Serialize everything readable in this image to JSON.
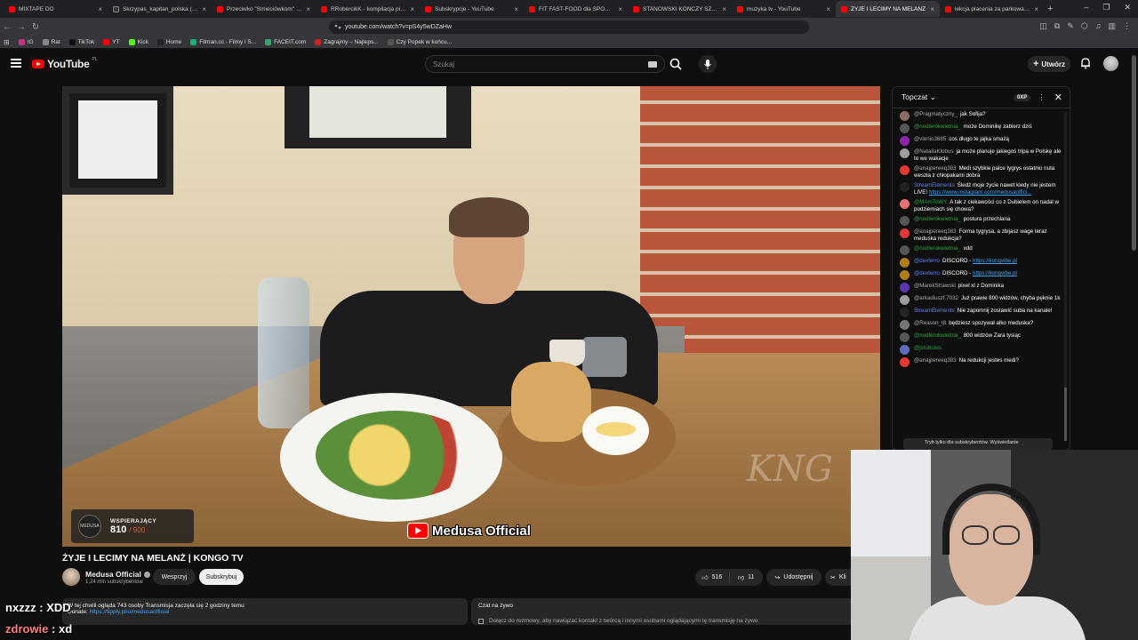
{
  "browser": {
    "tabs": [
      {
        "title": "MIXTAPE DO",
        "active": false
      },
      {
        "title": "Skrzypas_kapitan_polska (@skrzyp",
        "active": false
      },
      {
        "title": "Przeciwko \"Śmieciówkom\" - YouT",
        "active": false
      },
      {
        "title": "RRobercikK - kompilacja pianek - ",
        "active": false
      },
      {
        "title": "Subskrypcje - YouTube",
        "active": false
      },
      {
        "title": "FIT FAST-FOOD dla SPORTOWCÓ",
        "active": false
      },
      {
        "title": "STANOWSKI KOŃCZY SZEMRANĄ",
        "active": false
      },
      {
        "title": "muzyka tv - YouTube",
        "active": false
      },
      {
        "title": "ŻYJE I LECIMY NA MELANŻ",
        "active": true
      },
      {
        "title": "lekcja placenia za parkowanie - Yo",
        "active": false
      }
    ],
    "url": "youtube.com/watch?v=pS4y5wDZaHw",
    "bookmarks": [
      "IG",
      "Rat",
      "TikTok",
      "YT",
      "Kick",
      "Home",
      "Filman.cc - Filmy i S...",
      "FACEIT.com",
      "Zagrajmy – Najleps...",
      "Czy Popek w końcu..."
    ]
  },
  "youtube": {
    "logo_text": "YouTube",
    "country": "PL",
    "search_placeholder": "Szukaj",
    "create_label": "Utwórz"
  },
  "video": {
    "title": "ŻYJE I LECIMY NA MELANŻ | KONGO TV",
    "support_label": "WSPIERAJĄCY",
    "support_count": "810",
    "support_goal": "/ 900",
    "support_logo": "MEDUSA",
    "overlay_channel": "Medusa Official",
    "watermark": "KNG"
  },
  "channel": {
    "name": "Medusa Official",
    "subscribers": "1,24 mln subskrybentów",
    "support_label": "Wesprzyj",
    "subscribe_label": "Subskrybuj"
  },
  "actions": {
    "likes": "516",
    "dislikes": "11",
    "share_label": "Udostępnij",
    "clip_label": "Kli"
  },
  "description": {
    "line1": "W tej chwili ogląda 743 osoby  Transmisja zaczęła się 2 godziny temu",
    "donate_label": "Donate:",
    "donate_link": "https://tipply.pl/u/medusaofficial"
  },
  "live_chat_card": {
    "title": "Czat na żywo",
    "text": "Dołącz do rozmowy, aby nawiązać kontakt z twórcą i innymi osobami oglądającymi tę transmisję na żywo"
  },
  "chat": {
    "header": "Topczat",
    "xp_badge": "0XP",
    "footer": "Tryb tylko dla subskrybentów. Wyświetlanie",
    "messages": [
      {
        "nick": "@Pragmatyczny_",
        "text": "jak Sofija?",
        "color": "#8d6e63",
        "role": ""
      },
      {
        "nick": "@nodlerokwietnia_",
        "text": "może Dominikę zabierz dziś",
        "color": "#555555",
        "role": "mem"
      },
      {
        "nick": "@vlenio3685",
        "text": "cos dlugo te jajka smażą",
        "color": "#8e24aa",
        "role": ""
      },
      {
        "nick": "@NataliaKlobus",
        "text": "ja może planuje jakiegoś tripa w Polskę ale to we wakacje",
        "color": "#9e9e9e",
        "role": ""
      },
      {
        "nick": "@anajpereeq383",
        "text": "Medi szybkie palce tygrys ostatnio nuta weszła z chłopakami dobra",
        "color": "#e53935",
        "role": ""
      },
      {
        "nick": "StreamElements",
        "text": "Śledź moje życie nawet kiedy nie jestem LIVE!",
        "link": "https://www.instagram.com/medusaoffici...",
        "color": "#222222",
        "role": "mod"
      },
      {
        "nick": "@MAmToWY",
        "text": "A tak z ciekawości co z Dubielem on nadal w podziemiach się chowa?",
        "color": "#e57373",
        "role": "mem"
      },
      {
        "nick": "@nodlerokwietnia_",
        "text": "postura przechlana",
        "color": "#555555",
        "role": "mem"
      },
      {
        "nick": "@anajpereeq383",
        "text": "Forma tygrysa, a zbijasz wage teraz meduska redukcja?",
        "color": "#e53935",
        "role": ""
      },
      {
        "nick": "@nodlerokwietnia_",
        "text": "xdd",
        "color": "#555555",
        "role": "mem"
      },
      {
        "nick": "@dexterro",
        "text": "DISCORD -",
        "link": "https://kongvibe.pl",
        "color": "#b07d1a",
        "role": "mod"
      },
      {
        "nick": "@dexterro",
        "text": "DISCORD -",
        "link": "https://kongvibe.pl",
        "color": "#b07d1a",
        "role": "mod"
      },
      {
        "nick": "@MarekStrawski",
        "text": "pixel xl z Dominika",
        "color": "#5e35b1",
        "role": ""
      },
      {
        "nick": "@arkadiuszf.7032",
        "text": "Już prawie 800 widzów, chyba pęknie 1k",
        "color": "#9e9e9e",
        "role": ""
      },
      {
        "nick": "StreamElements",
        "text": "Nie zapomnij zostawić suba na kanale!",
        "color": "#222222",
        "role": "mod"
      },
      {
        "nick": "@Reason_t8",
        "text": "będziesz spozywał alko meduska?",
        "color": "#777777",
        "role": ""
      },
      {
        "nick": "@nodlerokwietnia_",
        "text": "800 widzów Zara tysiąc",
        "color": "#555555",
        "role": "mem"
      },
      {
        "nick": "@jstubcioo",
        "text": "",
        "color": "#5c6bc0",
        "role": "mem"
      },
      {
        "nick": "@anajpereeq383",
        "text": "Na redukcji jestes medi?",
        "color": "#e53935",
        "role": ""
      }
    ]
  },
  "stream_overlay": {
    "line1_user": "nxzzz",
    "line1_text": "XDD",
    "line2_user": "zdrowie",
    "line2_text": "xd"
  }
}
